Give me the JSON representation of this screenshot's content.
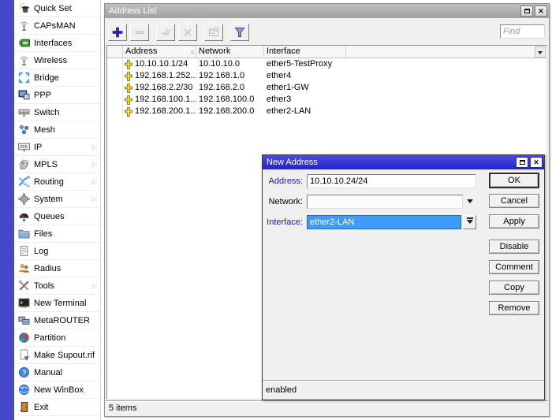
{
  "sidebar": {
    "items": [
      {
        "label": "Quick Set",
        "icon": "wand-icon"
      },
      {
        "label": "CAPsMAN",
        "icon": "antenna-icon"
      },
      {
        "label": "Interfaces",
        "icon": "interface-card-icon"
      },
      {
        "label": "Wireless",
        "icon": "wireless-antenna-icon"
      },
      {
        "label": "Bridge",
        "icon": "bridge-arrows-icon"
      },
      {
        "label": "PPP",
        "icon": "ppp-monitor-icon"
      },
      {
        "label": "Switch",
        "icon": "switch-icon"
      },
      {
        "label": "Mesh",
        "icon": "mesh-nodes-icon"
      },
      {
        "label": "IP",
        "icon": "ip-255-icon",
        "has_submenu": true
      },
      {
        "label": "MPLS",
        "icon": "mpls-tags-icon",
        "has_submenu": true
      },
      {
        "label": "Routing",
        "icon": "routing-arrows-icon",
        "has_submenu": true
      },
      {
        "label": "System",
        "icon": "gear-icon",
        "has_submenu": true
      },
      {
        "label": "Queues",
        "icon": "gauge-icon"
      },
      {
        "label": "Files",
        "icon": "folder-icon"
      },
      {
        "label": "Log",
        "icon": "log-sheet-icon"
      },
      {
        "label": "Radius",
        "icon": "people-icon"
      },
      {
        "label": "Tools",
        "icon": "tools-icon",
        "has_submenu": true
      },
      {
        "label": "New Terminal",
        "icon": "terminal-icon"
      },
      {
        "label": "MetaROUTER",
        "icon": "metarouter-icon"
      },
      {
        "label": "Partition",
        "icon": "pie-chart-icon"
      },
      {
        "label": "Make Supout.rif",
        "icon": "supout-sheet-icon"
      },
      {
        "label": "Manual",
        "icon": "question-icon"
      },
      {
        "label": "New WinBox",
        "icon": "globe-icon"
      },
      {
        "label": "Exit",
        "icon": "exit-door-icon"
      }
    ]
  },
  "window": {
    "title": "Address List",
    "status": "5 items"
  },
  "toolbar": {
    "find_placeholder": "Find",
    "buttons": [
      {
        "name": "add",
        "icon": "plus-icon",
        "enabled": true
      },
      {
        "name": "remove",
        "icon": "minus-icon",
        "enabled": false
      },
      {
        "name": "enable",
        "icon": "check-icon",
        "enabled": false
      },
      {
        "name": "disable",
        "icon": "cross-icon",
        "enabled": false
      },
      {
        "name": "comment",
        "icon": "comment-icon",
        "enabled": false
      },
      {
        "name": "filter",
        "icon": "funnel-icon",
        "enabled": true
      }
    ]
  },
  "table": {
    "columns": [
      "Address",
      "Network",
      "Interface"
    ],
    "sort": {
      "column": "Address",
      "dir": "asc"
    },
    "rows": [
      {
        "address": "10.10.10.1/24",
        "network": "10.10.10.0",
        "interface": "ether5-TestProxy"
      },
      {
        "address": "192.168.1.252...",
        "network": "192.168.1.0",
        "interface": "ether4"
      },
      {
        "address": "192.168.2.2/30",
        "network": "192.168.2.0",
        "interface": "ether1-GW"
      },
      {
        "address": "192.168.100.1...",
        "network": "192.168.100.0",
        "interface": "ether3"
      },
      {
        "address": "192.168.200.1...",
        "network": "192.168.200.0",
        "interface": "ether2-LAN"
      }
    ]
  },
  "dialog": {
    "title": "New Address",
    "fields": {
      "address": {
        "label": "Address:",
        "value": "10.10.10.24/24"
      },
      "network": {
        "label": "Network:",
        "value": ""
      },
      "interface": {
        "label": "Interface:",
        "value": "ether2-LAN"
      }
    },
    "buttons": [
      "OK",
      "Cancel",
      "Apply",
      "Disable",
      "Comment",
      "Copy",
      "Remove"
    ],
    "status": "enabled"
  },
  "colors": {
    "titlebar_active": "#2e2ed8",
    "titlebar_inactive": "#a9a9a9",
    "selection_blue": "#3d9bfc",
    "sidebar_strip": "#4647c9",
    "field_label_blue": "#1a1acc",
    "row_icon_yellow": "#f0d24a"
  }
}
